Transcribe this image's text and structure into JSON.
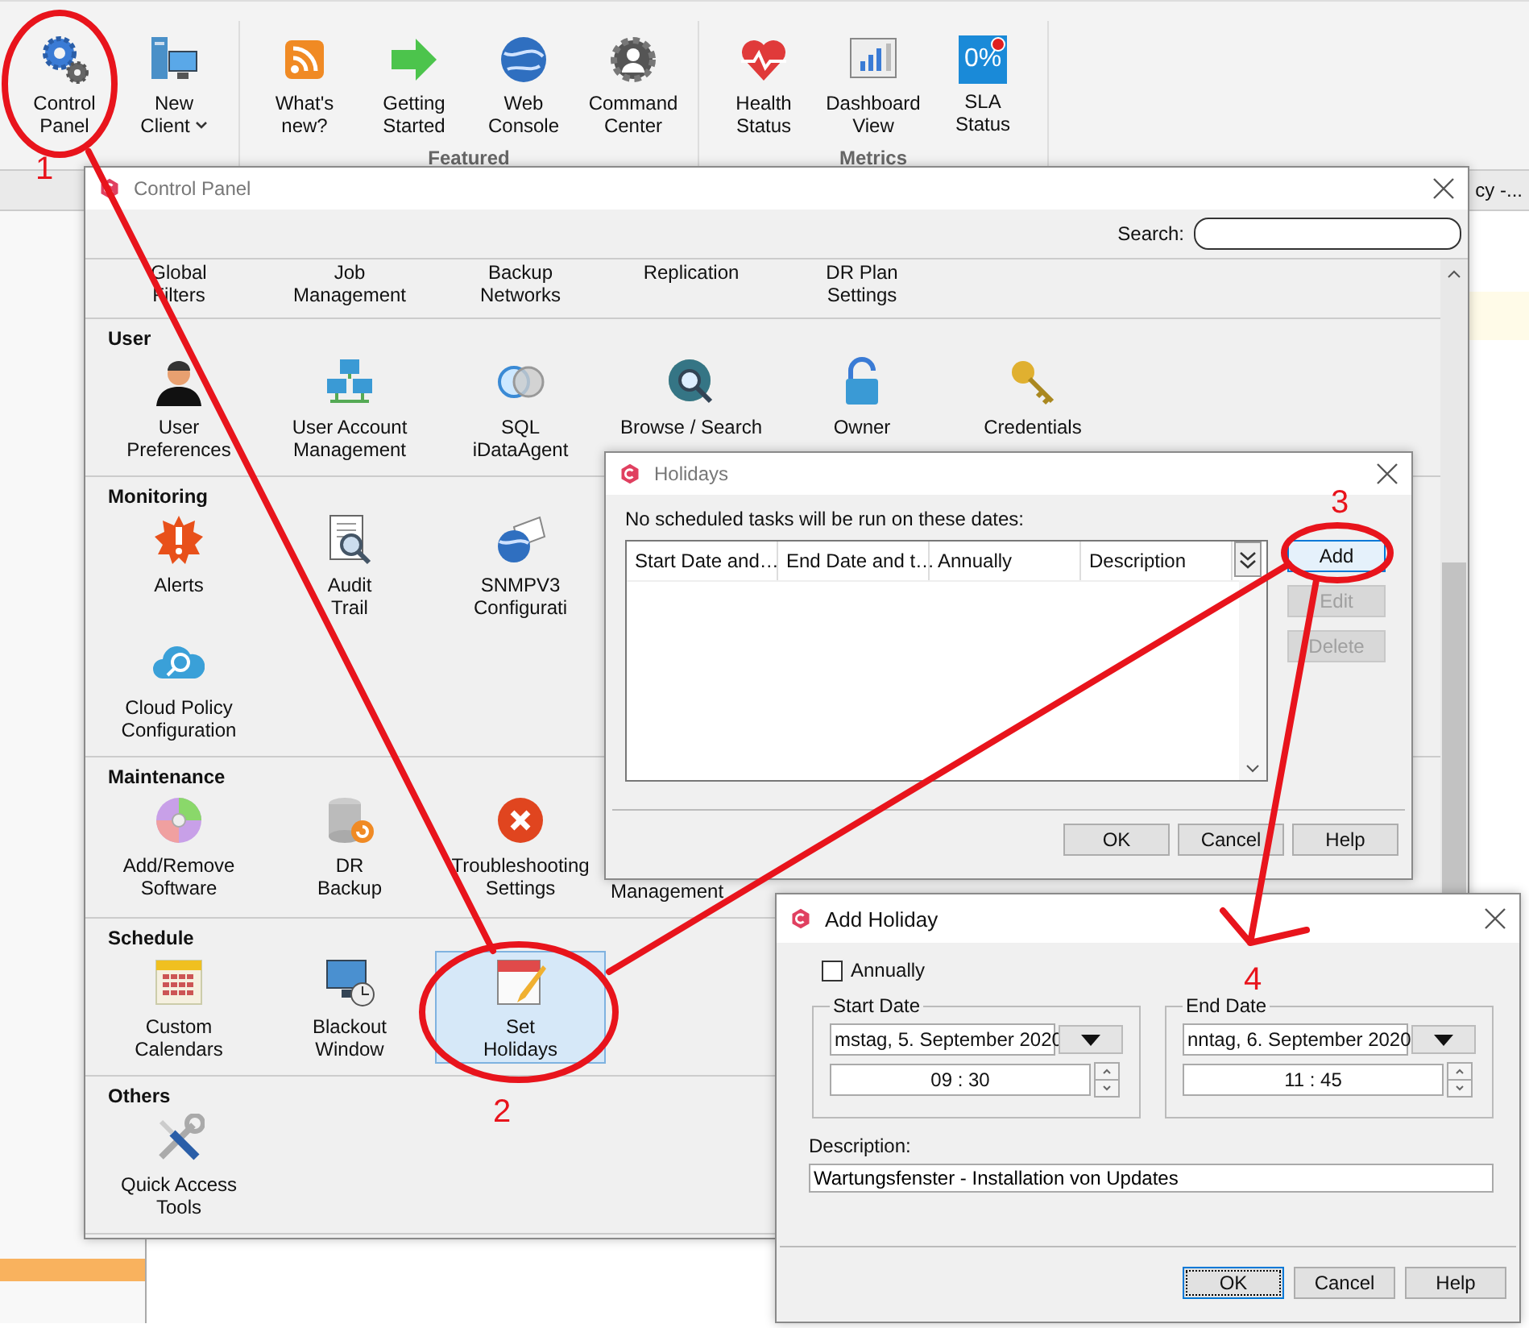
{
  "ribbon": {
    "groups": [
      {
        "items": [
          {
            "kind": "gears",
            "label": "Control\nPanel"
          },
          {
            "kind": "computer",
            "label": "New\nClient",
            "dropdown": true
          }
        ]
      },
      {
        "title": "Featured",
        "items": [
          {
            "kind": "rss",
            "label": "What's\nnew?"
          },
          {
            "kind": "arrow",
            "label": "Getting\nStarted"
          },
          {
            "kind": "globe",
            "label": "Web\nConsole"
          },
          {
            "kind": "command",
            "label": "Command\nCenter"
          }
        ]
      },
      {
        "title": "Metrics",
        "items": [
          {
            "kind": "heart",
            "label": "Health\nStatus"
          },
          {
            "kind": "dashboard",
            "label": "Dashboard\nView"
          },
          {
            "kind": "sla",
            "label": "SLA\nStatus",
            "tile_text": "0%"
          }
        ]
      }
    ]
  },
  "background_tab": "cy -...",
  "control_panel": {
    "title": "Control Panel",
    "search_label": "Search:",
    "sections": [
      {
        "rows": [
          [
            {
              "kind": "scrolled",
              "label": "Global\nFilters",
              "selected": false
            },
            {
              "kind": "scrolled",
              "label": "Job\nManagement",
              "selected": false
            },
            {
              "kind": "scrolled",
              "label": "Backup\nNetworks",
              "selected": false
            },
            {
              "kind": "scrolled",
              "label": "Replication",
              "selected": false
            },
            {
              "kind": "scrolled",
              "label": "DR Plan\nSettings",
              "selected": false
            }
          ]
        ]
      },
      {
        "title": "User",
        "rows": [
          [
            {
              "kind": "user",
              "label": "User\nPreferences",
              "selected": false
            },
            {
              "kind": "network",
              "label": "User Account\nManagement",
              "selected": false
            },
            {
              "kind": "circles",
              "label": "SQL\niDataAgent",
              "selected": false
            },
            {
              "kind": "globe-search",
              "label": "Browse / Search",
              "selected": false
            },
            {
              "kind": "lock",
              "label": "Owner",
              "selected": false
            },
            {
              "kind": "key",
              "label": "Credentials",
              "selected": false
            }
          ]
        ]
      },
      {
        "title": "Monitoring",
        "rows": [
          [
            {
              "kind": "alert",
              "label": "Alerts",
              "selected": false
            },
            {
              "kind": "document-search",
              "label": "Audit\nTrail",
              "selected": false
            },
            {
              "kind": "globe-envelope",
              "label": "SNMPV3\nConfigurati",
              "selected": false
            }
          ],
          [
            {
              "kind": "cloud-search",
              "label": "Cloud Policy\nConfiguration",
              "selected": false
            }
          ]
        ]
      },
      {
        "title": "Maintenance",
        "rows": [
          [
            {
              "kind": "disc",
              "label": "Add/Remove\nSoftware",
              "selected": false
            },
            {
              "kind": "database",
              "label": "DR\nBackup",
              "selected": false
            },
            {
              "kind": "error",
              "label": "Troubleshooting\nSettings",
              "selected": false
            },
            {
              "kind": "covered",
              "label": "Management"
            }
          ]
        ]
      },
      {
        "title": "Schedule",
        "rows": [
          [
            {
              "kind": "calendar",
              "label": "Custom\nCalendars",
              "selected": false
            },
            {
              "kind": "monitor-clock",
              "label": "Blackout\nWindow",
              "selected": false
            },
            {
              "kind": "calendar-pencil",
              "label": "Set\nHolidays",
              "selected": true
            }
          ]
        ]
      },
      {
        "title": "Others",
        "rows": [
          [
            {
              "kind": "tools",
              "label": "Quick Access\nTools",
              "selected": false
            }
          ]
        ]
      }
    ]
  },
  "holidays": {
    "title": "Holidays",
    "note": "No scheduled tasks will be run on these dates:",
    "columns": [
      "Start Date and…",
      "End Date and t…",
      "Annually",
      "Description"
    ],
    "side_buttons": [
      {
        "label": "Add",
        "disabled": false,
        "focused": true
      },
      {
        "label": "Edit",
        "disabled": true,
        "focused": false
      },
      {
        "label": "Delete",
        "disabled": true,
        "focused": false
      }
    ],
    "buttons": [
      {
        "label": "OK",
        "focused": false
      },
      {
        "label": "Cancel",
        "focused": false
      },
      {
        "label": "Help",
        "focused": false
      }
    ]
  },
  "add_holiday": {
    "title": "Add Holiday",
    "annually": {
      "label": "Annually",
      "checked": false
    },
    "start": {
      "legend": "Start Date",
      "date": "mstag, 5. September 2020",
      "time": "09 : 30"
    },
    "end": {
      "legend": "End Date",
      "date": "nntag, 6. September 2020",
      "time": "11 : 45"
    },
    "description_label": "Description:",
    "description": "Wartungsfenster - Installation von Updates",
    "buttons": [
      {
        "label": "OK",
        "focused": true
      },
      {
        "label": "Cancel",
        "focused": false
      },
      {
        "label": "Help",
        "focused": false
      }
    ]
  },
  "annotations": [
    "1",
    "2",
    "3",
    "4"
  ]
}
